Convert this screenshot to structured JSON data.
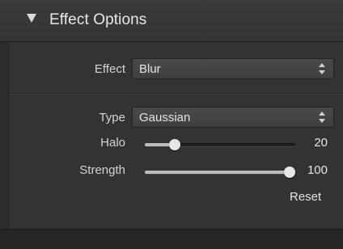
{
  "panel": {
    "title": "Effect Options",
    "expanded": true
  },
  "effect": {
    "label": "Effect",
    "value": "Blur"
  },
  "type": {
    "label": "Type",
    "value": "Gaussian"
  },
  "halo": {
    "label": "Halo",
    "value": "20",
    "fraction": 0.2
  },
  "strength": {
    "label": "Strength",
    "value": "100",
    "fraction": 1.0
  },
  "reset_label": "Reset",
  "colors": {
    "background": "#2d2d2d",
    "panel_body": "#333333",
    "text": "#d9d9d9",
    "slider_thumb": "#e6e6e6"
  }
}
